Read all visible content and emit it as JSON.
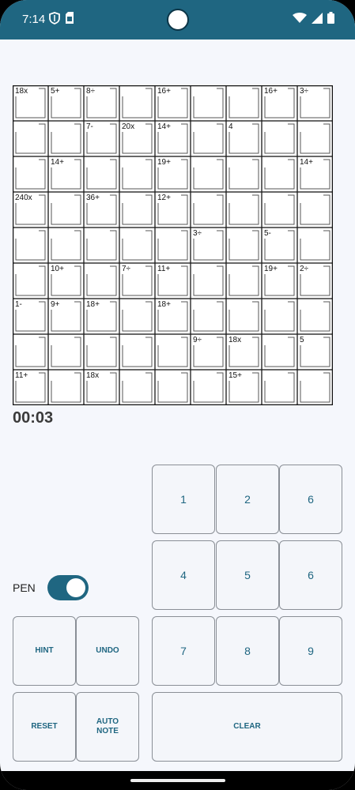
{
  "status_bar": {
    "time": "7:14",
    "icons": [
      "shield-icon",
      "sim-card-icon",
      "wifi-icon",
      "cellular-icon",
      "battery-icon"
    ]
  },
  "puzzle": {
    "size": 9,
    "cages": [
      {
        "label": "18x",
        "r": 0,
        "c": 0
      },
      {
        "label": "5+",
        "r": 0,
        "c": 1
      },
      {
        "label": "8÷",
        "r": 0,
        "c": 2
      },
      {
        "label": "16+",
        "r": 0,
        "c": 4
      },
      {
        "label": "16+",
        "r": 0,
        "c": 7
      },
      {
        "label": "3÷",
        "r": 0,
        "c": 8
      },
      {
        "label": "7-",
        "r": 1,
        "c": 2
      },
      {
        "label": "20x",
        "r": 1,
        "c": 3
      },
      {
        "label": "14+",
        "r": 1,
        "c": 4
      },
      {
        "label": "4",
        "r": 1,
        "c": 6
      },
      {
        "label": "14+",
        "r": 2,
        "c": 1
      },
      {
        "label": "19+",
        "r": 2,
        "c": 4
      },
      {
        "label": "14+",
        "r": 2,
        "c": 8
      },
      {
        "label": "240x",
        "r": 3,
        "c": 0
      },
      {
        "label": "36+",
        "r": 3,
        "c": 2
      },
      {
        "label": "12+",
        "r": 3,
        "c": 4
      },
      {
        "label": "3÷",
        "r": 4,
        "c": 5
      },
      {
        "label": "5-",
        "r": 4,
        "c": 7
      },
      {
        "label": "10+",
        "r": 5,
        "c": 1
      },
      {
        "label": "7÷",
        "r": 5,
        "c": 3
      },
      {
        "label": "11+",
        "r": 5,
        "c": 4
      },
      {
        "label": "19+",
        "r": 5,
        "c": 7
      },
      {
        "label": "2÷",
        "r": 5,
        "c": 8
      },
      {
        "label": "1-",
        "r": 6,
        "c": 0
      },
      {
        "label": "9+",
        "r": 6,
        "c": 1
      },
      {
        "label": "18+",
        "r": 6,
        "c": 2
      },
      {
        "label": "18+",
        "r": 6,
        "c": 4
      },
      {
        "label": "9÷",
        "r": 7,
        "c": 5
      },
      {
        "label": "18x",
        "r": 7,
        "c": 6
      },
      {
        "label": "5",
        "r": 7,
        "c": 8
      },
      {
        "label": "11+",
        "r": 8,
        "c": 0
      },
      {
        "label": "18x",
        "r": 8,
        "c": 2
      },
      {
        "label": "15+",
        "r": 8,
        "c": 6
      }
    ]
  },
  "timer": "00:03",
  "pen": {
    "label": "PEN",
    "on": true
  },
  "controls": {
    "hint": "HINT",
    "undo": "UNDO",
    "reset": "RESET",
    "auto_note": "AUTO NOTE",
    "clear": "CLEAR"
  },
  "keypad": [
    "1",
    "2",
    "6",
    "4",
    "5",
    "6",
    "7",
    "8",
    "9"
  ],
  "colors": {
    "accent": "#1f6681",
    "background": "#f5f7fc"
  }
}
